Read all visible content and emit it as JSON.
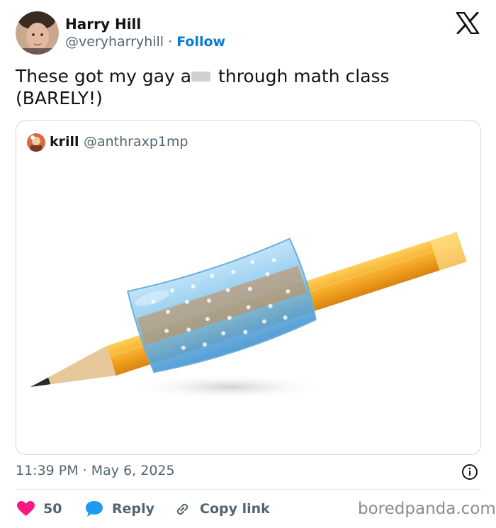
{
  "author": {
    "name": "Harry Hill",
    "handle": "@veryharryhill",
    "separator": " · ",
    "follow_label": "Follow"
  },
  "tweet": {
    "text_part1": "These got my gay a",
    "text_part2": " through math class",
    "text_line2": "(BARELY!)"
  },
  "quote": {
    "name": "krill",
    "handle": "@anthraxp1mp",
    "image_description_icon": "pencil-with-grip-image"
  },
  "meta": {
    "timestamp": "11:39 PM · May 6, 2025"
  },
  "actions": {
    "likes_count": "50",
    "reply_label": "Reply",
    "copy_link_label": "Copy link"
  },
  "watermark": "boredpanda.com",
  "colors": {
    "like": "#f91880",
    "reply": "#1d9bf0",
    "follow": "#0a7ad4",
    "muted": "#536471"
  }
}
